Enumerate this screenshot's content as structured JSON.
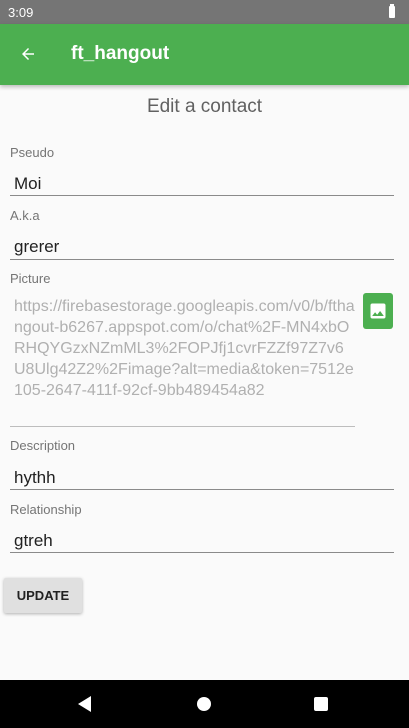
{
  "status_bar": {
    "time": "3:09"
  },
  "app_bar": {
    "title": "ft_hangout",
    "back_icon": "arrow-back-icon"
  },
  "screen": {
    "heading": "Edit a contact"
  },
  "form": {
    "pseudo": {
      "label": "Pseudo",
      "value": "Moi"
    },
    "aka": {
      "label": "A.k.a",
      "value": "grerer"
    },
    "picture": {
      "label": "Picture",
      "value": "https://firebasestorage.googleapis.com/v0/b/fthangout-b6267.appspot.com/o/chat%2F-MN4xbORHQYGzxNZmML3%2FOPJfj1cvrFZZf97Z7v6U8Ulg42Z2%2Fimage?alt=media&token=7512e105-2647-411f-92cf-9bb489454a82",
      "button_icon": "image-icon"
    },
    "description": {
      "label": "Description",
      "value": "hythh"
    },
    "relationship": {
      "label": "Relationship",
      "value": "gtreh"
    },
    "update_label": "UPDATE"
  },
  "colors": {
    "primary": "#4caf50",
    "status_bar": "#757575"
  }
}
